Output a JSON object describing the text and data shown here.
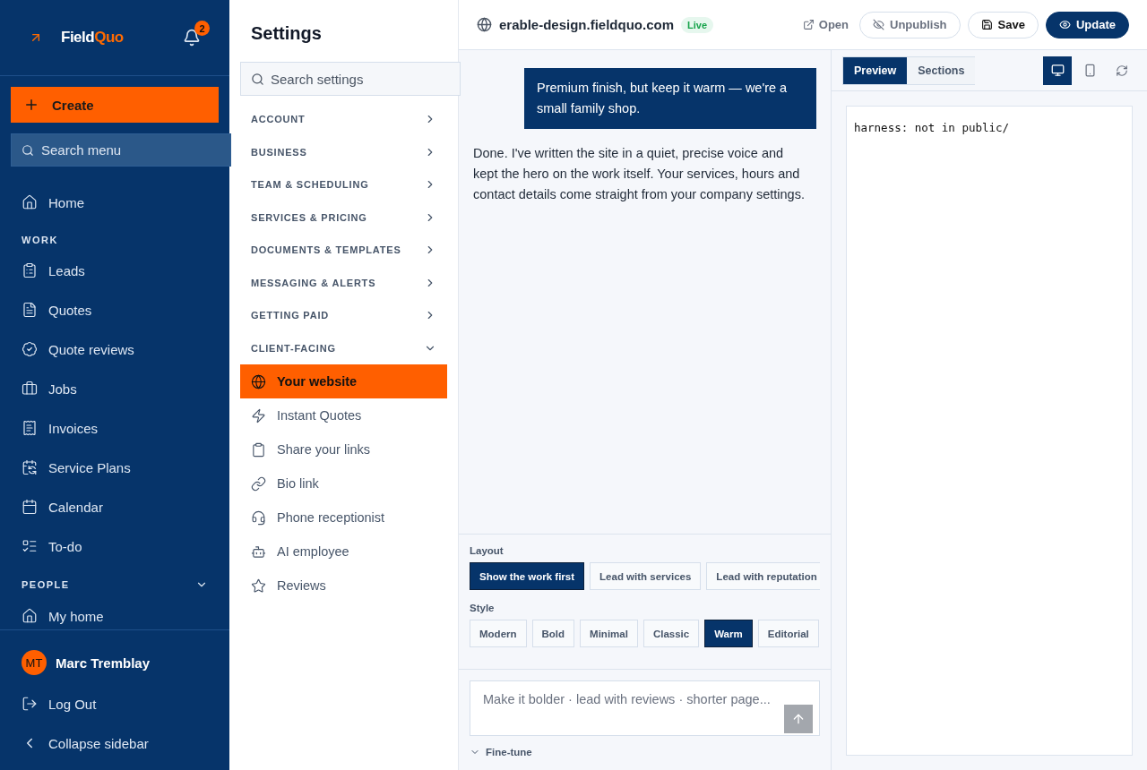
{
  "sidebar": {
    "logo": {
      "text": "Field",
      "accent": "Quo"
    },
    "notifications": "2",
    "create": "Create",
    "search": {
      "placeholder": "Search menu"
    },
    "sections": [
      {
        "items": [
          {
            "label": "Home"
          }
        ]
      },
      {
        "title": "WORK",
        "items": [
          {
            "label": "Leads"
          },
          {
            "label": "Quotes"
          },
          {
            "label": "Quote reviews"
          },
          {
            "label": "Jobs"
          },
          {
            "label": "Invoices"
          },
          {
            "label": "Service Plans"
          },
          {
            "label": "Calendar"
          },
          {
            "label": "To-do"
          }
        ]
      },
      {
        "title": "PEOPLE",
        "expanded": true,
        "items": [
          {
            "label": "My home"
          }
        ]
      }
    ],
    "user": {
      "initials": "MT",
      "name": "Marc Tremblay"
    },
    "logout": "Log Out",
    "collapse": "Collapse sidebar"
  },
  "settings": {
    "title": "Settings",
    "search": {
      "placeholder": "Search settings"
    },
    "groups": [
      {
        "label": "ACCOUNT",
        "expanded": false
      },
      {
        "label": "BUSINESS",
        "expanded": false
      },
      {
        "label": "TEAM & SCHEDULING",
        "expanded": false
      },
      {
        "label": "SERVICES & PRICING",
        "expanded": false
      },
      {
        "label": "DOCUMENTS & TEMPLATES",
        "expanded": false
      },
      {
        "label": "MESSAGING & ALERTS",
        "expanded": false
      },
      {
        "label": "GETTING PAID",
        "expanded": false
      },
      {
        "label": "CLIENT-FACING",
        "expanded": true,
        "items": [
          {
            "label": "Your website",
            "selected": true
          },
          {
            "label": "Instant Quotes",
            "selected": false
          },
          {
            "label": "Share your links",
            "selected": false
          },
          {
            "label": "Bio link",
            "selected": false
          },
          {
            "label": "Phone receptionist",
            "selected": false
          },
          {
            "label": "AI employee",
            "selected": false
          },
          {
            "label": "Reviews",
            "selected": false
          }
        ]
      }
    ]
  },
  "topbar": {
    "domain": "erable-design.fieldquo.com",
    "status": "Live",
    "open": "Open",
    "unpublish": "Unpublish",
    "save": "Save",
    "update": "Update"
  },
  "chat": {
    "messages": [
      {
        "kind": "user",
        "text": "Premium finish, but keep it warm — we're a small family shop."
      },
      {
        "kind": "assistant",
        "text": "Done. I've written the site in a quiet, precise voice and kept the hero on the work itself. Your services, hours and contact details come straight from your company settings."
      }
    ],
    "layout": {
      "label": "Layout",
      "options": [
        {
          "label": "Show the work first",
          "selected": true
        },
        {
          "label": "Lead with services",
          "selected": false
        },
        {
          "label": "Lead with reputation",
          "selected": false
        }
      ]
    },
    "style": {
      "label": "Style",
      "options": [
        {
          "label": "Modern",
          "selected": false
        },
        {
          "label": "Bold",
          "selected": false
        },
        {
          "label": "Minimal",
          "selected": false
        },
        {
          "label": "Classic",
          "selected": false
        },
        {
          "label": "Warm",
          "selected": true
        },
        {
          "label": "Editorial",
          "selected": false
        }
      ]
    },
    "input": {
      "placeholder": "Make it bolder · lead with reviews · shorter page..."
    },
    "finetune": {
      "label": "Fine-tune",
      "expanded": false
    }
  },
  "preview": {
    "tabs": [
      {
        "label": "Preview",
        "selected": true
      },
      {
        "label": "Sections",
        "selected": false
      }
    ],
    "devices": [
      {
        "selected": true
      },
      {
        "selected": false
      }
    ],
    "content": "harness: not in public/"
  }
}
